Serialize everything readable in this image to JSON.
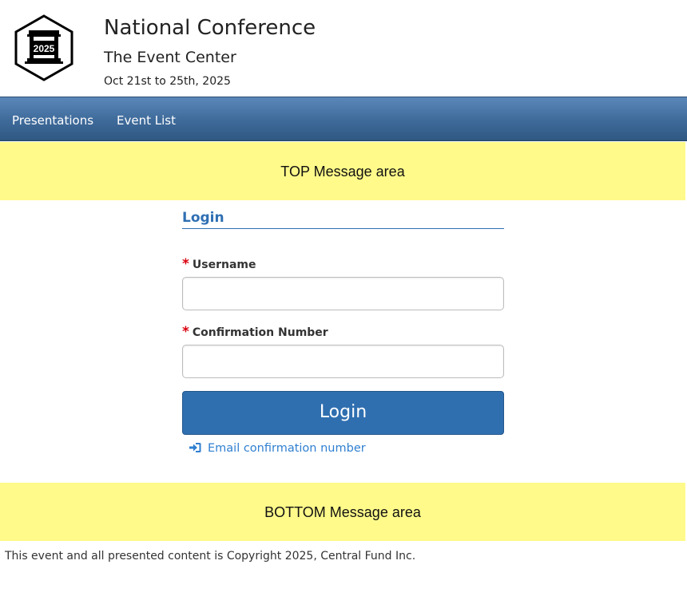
{
  "header": {
    "logo": {
      "icon": "columned-building-hexagon-icon",
      "year": "2025"
    },
    "title": "National Conference",
    "venue": "The Event Center",
    "dates": "Oct 21st to 25th, 2025"
  },
  "nav": {
    "items": [
      {
        "label": "Presentations"
      },
      {
        "label": "Event List"
      }
    ]
  },
  "messages": {
    "top": "TOP Message area",
    "bottom": "BOTTOM Message area"
  },
  "login": {
    "heading": "Login",
    "required_marker": "*",
    "username_label": "Username",
    "username_value": "",
    "confirmation_label": "Confirmation Number",
    "confirmation_value": "",
    "submit_label": "Login",
    "email_link_icon": "sign-in-icon",
    "email_link_label": "Email confirmation number"
  },
  "footer": {
    "copyright": "This event and all presented content is Copyright 2025, Central Fund Inc."
  },
  "colors": {
    "nav_top": "#5a87b9",
    "nav_bottom": "#2f5782",
    "message_bg": "#fffa8a",
    "accent": "#2f6fb3",
    "required": "#d9000d",
    "link": "#2f7fd0"
  }
}
